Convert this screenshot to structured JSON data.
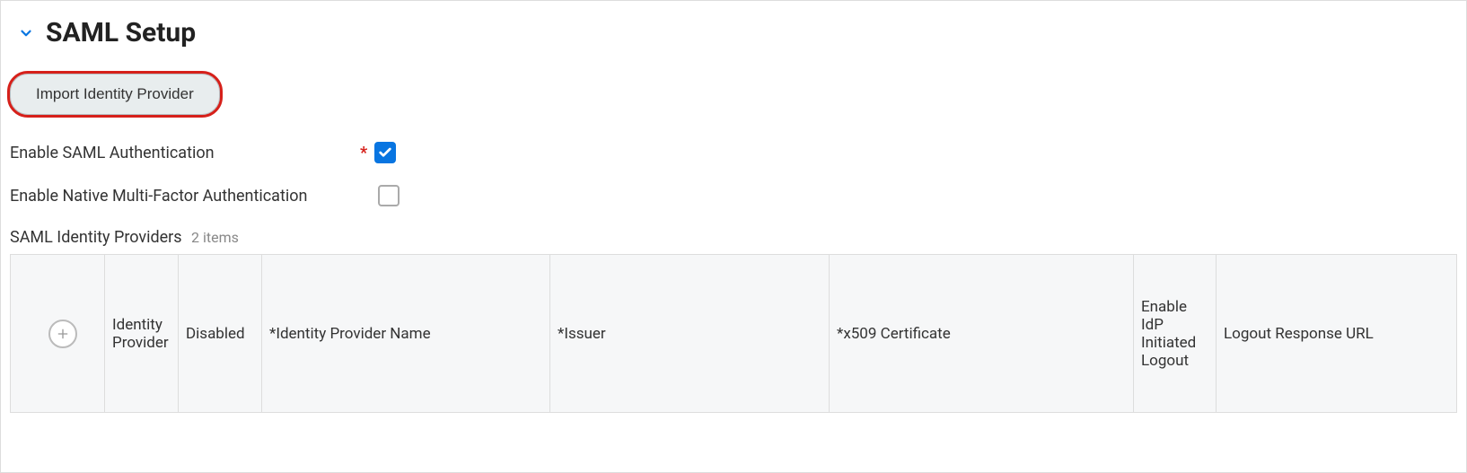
{
  "section": {
    "title": "SAML Setup"
  },
  "actions": {
    "import_button": "Import Identity Provider"
  },
  "fields": {
    "enable_saml": {
      "label": "Enable SAML Authentication",
      "required": true,
      "checked": true
    },
    "enable_mfa": {
      "label": "Enable Native Multi-Factor Authentication",
      "required": false,
      "checked": false
    }
  },
  "table": {
    "title": "SAML Identity Providers",
    "count_text": "2 items",
    "columns": {
      "identity_provider": "Identity Provider",
      "disabled": "Disabled",
      "name": "*Identity Provider Name",
      "issuer": "*Issuer",
      "cert": "*x509 Certificate",
      "enable_idp_logout": "Enable IdP Initiated Logout",
      "logout_url": "Logout Response URL"
    }
  }
}
